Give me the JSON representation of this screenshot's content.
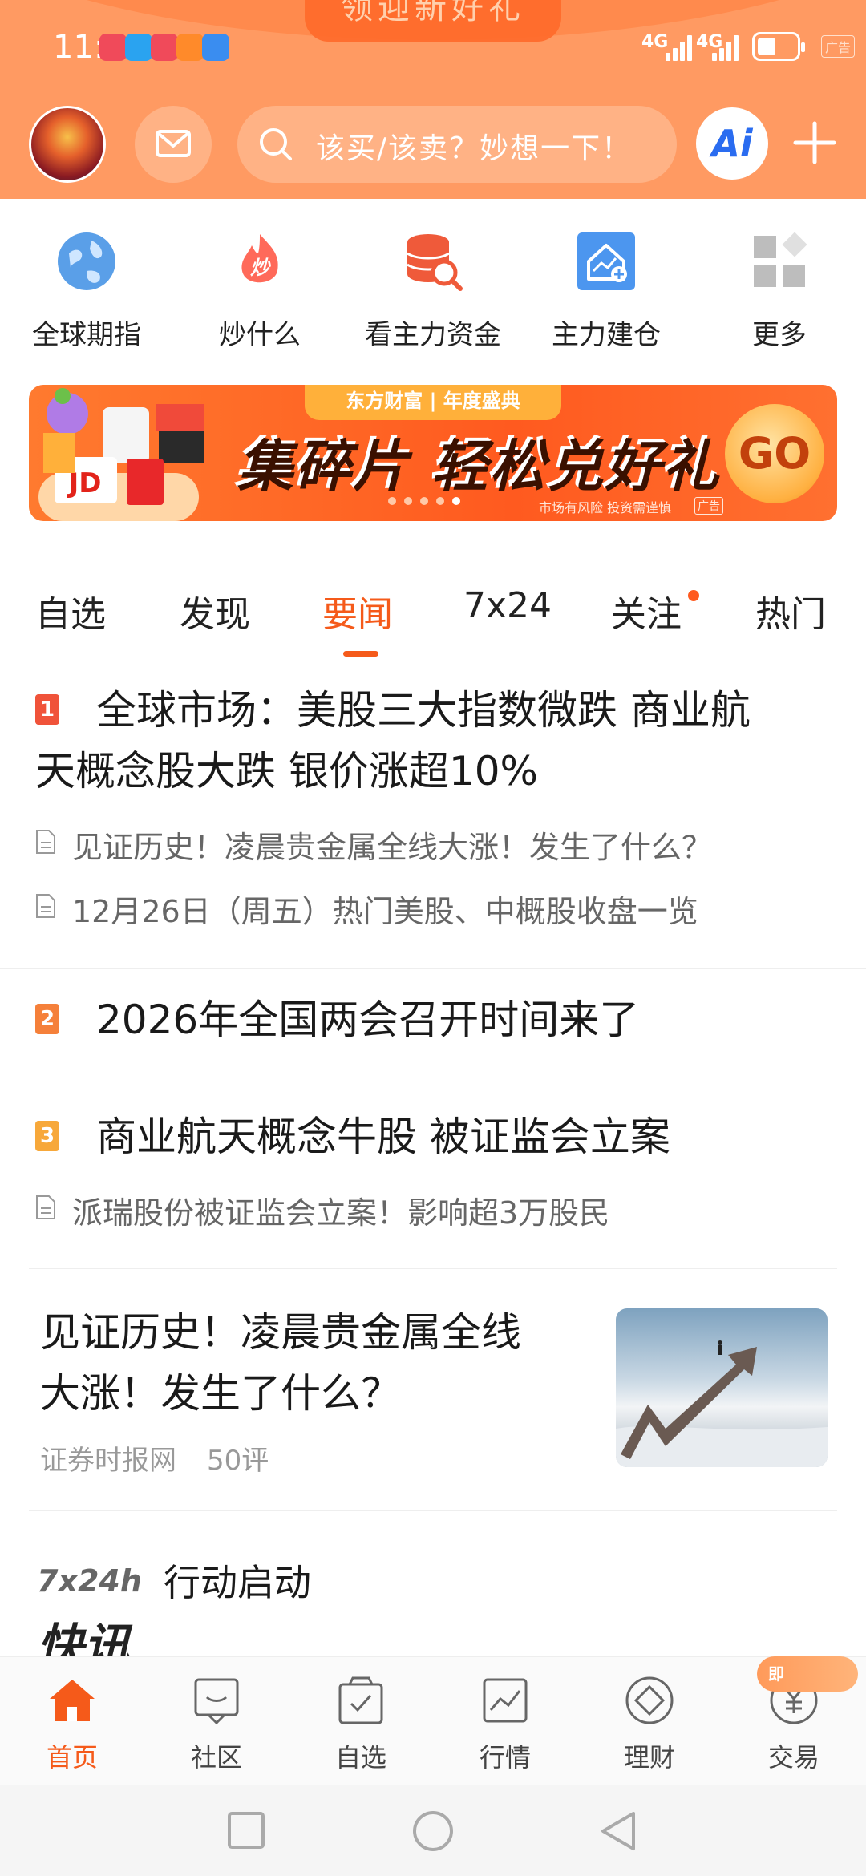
{
  "status_bar": {
    "time": "11:22",
    "net1": "4G",
    "net2": "4G",
    "ad_tag": "广告"
  },
  "top_promo": "领迎新好礼",
  "header": {
    "search_placeholder": "该买/该卖？妙想一下！",
    "ai_label": "Ai"
  },
  "quick_nav": [
    {
      "label": "全球期指",
      "icon": "globe-icon",
      "color": "#4a90e2"
    },
    {
      "label": "炒什么",
      "icon": "fire-icon",
      "color": "#ff5a4a",
      "glyph": "炒"
    },
    {
      "label": "看主力资金",
      "icon": "database-search-icon",
      "color": "#ef5a3a"
    },
    {
      "label": "主力建仓",
      "icon": "house-chart-icon",
      "color": "#3a8df0"
    },
    {
      "label": "更多",
      "icon": "grid-more-icon",
      "color": "#bbbbbb"
    }
  ],
  "banner": {
    "brand": "东方财富 | 年度盛典",
    "slogan": "集碎片 轻松兑好礼",
    "go_label": "GO",
    "risk_notice": "市场有风险 投资需谨慎",
    "ad_label": "广告",
    "dots_total": 5,
    "dots_active": 5
  },
  "tabs": {
    "items": [
      "自选",
      "发现",
      "要闻",
      "7x24",
      "关注",
      "热门"
    ],
    "active": "要闻"
  },
  "news": {
    "item1": {
      "rank": "1",
      "title_line1": "全球市场：美股三大指数微跌 商业航",
      "title_line2": "天概念股大跌 银价涨超10%",
      "sub1": "见证历史！凌晨贵金属全线大涨！发生了什么？",
      "sub2": "12月26日（周五）热门美股、中概股收盘一览"
    },
    "item2": {
      "rank": "2",
      "title": "2026年全国两会召开时间来了"
    },
    "item3": {
      "rank": "3",
      "title": "商业航天概念牛股 被证监会立案",
      "sub1": "派瑞股份被证监会立案！影响超3万股民"
    },
    "story": {
      "title_line1": "见证历史！凌晨贵金属全线",
      "title_line2": "大涨！发生了什么？",
      "source": "证券时报网",
      "comments": "50评"
    },
    "flash": {
      "brand_top": "7x24h",
      "brand_bottom": "快讯",
      "title": "行动启动"
    }
  },
  "bottom_nav": {
    "items": [
      {
        "label": "首页",
        "icon": "home-icon"
      },
      {
        "label": "社区",
        "icon": "chat-icon"
      },
      {
        "label": "自选",
        "icon": "bag-check-icon"
      },
      {
        "label": "行情",
        "icon": "chart-icon"
      },
      {
        "label": "理财",
        "icon": "diamond-icon"
      },
      {
        "label": "交易",
        "icon": "yen-icon"
      }
    ],
    "active": "首页",
    "trade_badge": "即"
  },
  "colors": {
    "accent": "#f55a1a",
    "header_bg": "#ff9a62"
  }
}
